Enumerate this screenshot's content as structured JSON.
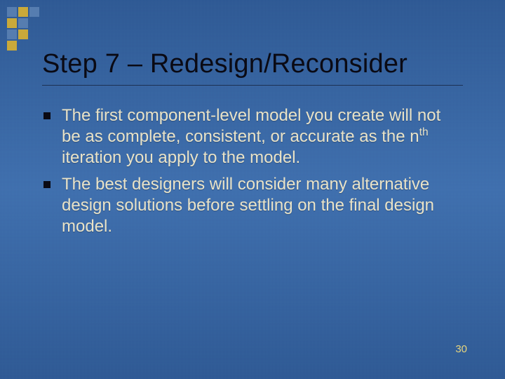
{
  "title": "Step 7 – Redesign/Reconsider",
  "bullets": [
    {
      "pre": "The first component-level model you create will not be as complete, consistent, or accurate as the n",
      "sup": "th",
      "post": " iteration you apply to the model."
    },
    {
      "pre": "The best designers will consider many alternative design solutions before settling on the final design model.",
      "sup": "",
      "post": ""
    }
  ],
  "page_number": "30"
}
